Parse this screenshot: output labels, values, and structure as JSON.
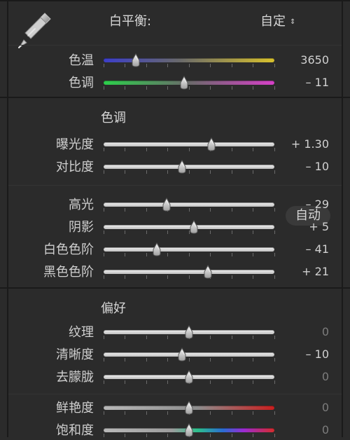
{
  "panels": {
    "white_balance": {
      "title": "白平衡:",
      "preset": "自定",
      "preset_arrows": "⇕",
      "rows": [
        {
          "key": "temperature",
          "label": "色温",
          "value": "3650",
          "position": 0.19,
          "track_style": "temperature"
        },
        {
          "key": "tint",
          "label": "色调",
          "value": "– 11",
          "position": 0.47,
          "track_style": "tint"
        }
      ]
    },
    "tone": {
      "title": "色调",
      "auto_label": "自动",
      "rows": [
        {
          "key": "exposure",
          "label": "曝光度",
          "value": "+ 1.30",
          "position": 0.63
        },
        {
          "key": "contrast",
          "label": "对比度",
          "value": "– 10",
          "position": 0.46
        }
      ],
      "rows2": [
        {
          "key": "highlights",
          "label": "高光",
          "value": "– 29",
          "position": 0.37
        },
        {
          "key": "shadows",
          "label": "阴影",
          "value": "+ 5",
          "position": 0.53
        },
        {
          "key": "whites",
          "label": "白色色阶",
          "value": "– 41",
          "position": 0.31
        },
        {
          "key": "blacks",
          "label": "黑色色阶",
          "value": "+ 21",
          "position": 0.61
        }
      ]
    },
    "presence": {
      "title": "偏好",
      "rows": [
        {
          "key": "texture",
          "label": "纹理",
          "value": "0",
          "position": 0.5,
          "dim": true
        },
        {
          "key": "clarity",
          "label": "清晰度",
          "value": "– 10",
          "position": 0.46,
          "dim": false
        },
        {
          "key": "dehaze",
          "label": "去朦胧",
          "value": "0",
          "position": 0.5,
          "dim": true
        }
      ],
      "rows2": [
        {
          "key": "vibrance",
          "label": "鲜艳度",
          "value": "0",
          "position": 0.5,
          "dim": true,
          "track_style": "vibrance"
        },
        {
          "key": "saturation",
          "label": "饱和度",
          "value": "0",
          "position": 0.5,
          "dim": true,
          "track_style": "saturation"
        }
      ]
    }
  },
  "icons": {
    "eyedropper": "eyedropper-icon"
  }
}
